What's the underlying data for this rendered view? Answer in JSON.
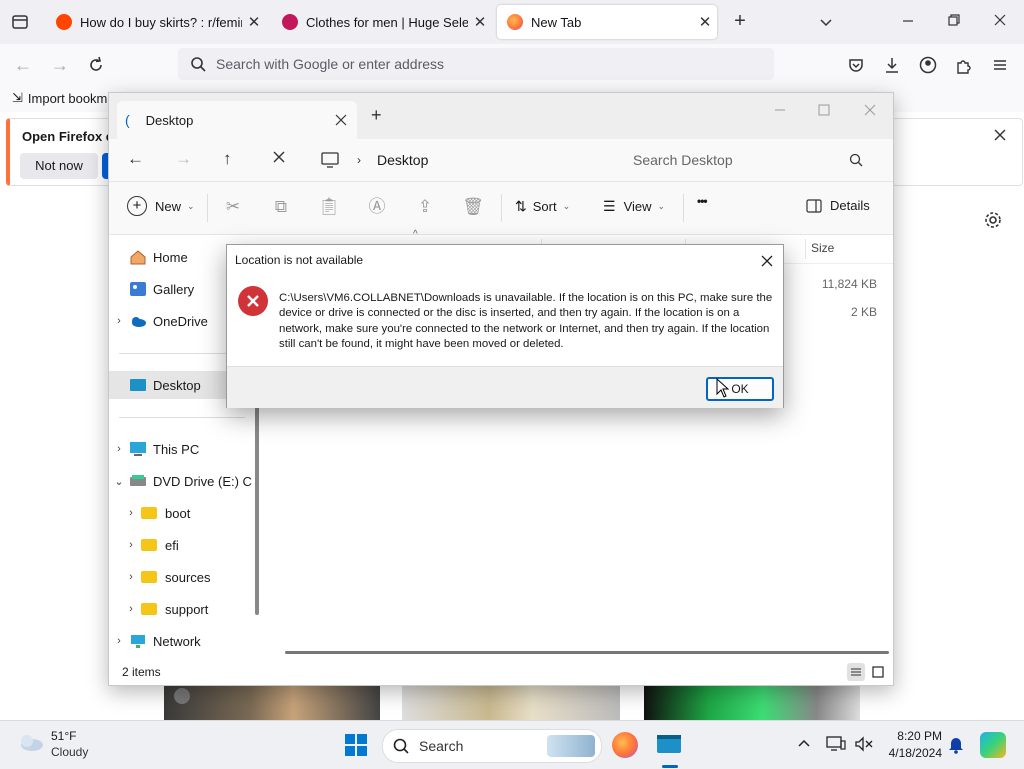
{
  "firefox": {
    "tabs": [
      {
        "title": "How do I buy skirts? : r/feminin",
        "favicon_color": "#ff4500"
      },
      {
        "title": "Clothes for men | Huge Selectio",
        "favicon_color": "#c2185b"
      },
      {
        "title": "New Tab",
        "favicon_color": "#ff7139"
      }
    ],
    "new_tab_symbol": "+",
    "url_placeholder": "Search with Google or enter address",
    "import_bookmarks": "Import bookm",
    "notification": {
      "title": "Open Firefox ev",
      "not_now": "Not now"
    },
    "accent": "#0061e0"
  },
  "explorer": {
    "tab_title": "Desktop",
    "new_tab_symbol": "+",
    "breadcrumb": "Desktop",
    "search_placeholder": "Search Desktop",
    "toolbar": {
      "new": "New",
      "sort": "Sort",
      "view": "View",
      "more": "•••",
      "details": "Details"
    },
    "nav": {
      "home": "Home",
      "gallery": "Gallery",
      "onedrive": "OneDrive",
      "desktop": "Desktop",
      "this_pc": "This PC",
      "dvd": "DVD Drive (E:) C",
      "boot": "boot",
      "efi": "efi",
      "sources": "sources",
      "support": "support",
      "network": "Network"
    },
    "columns": {
      "size": "Size"
    },
    "sizes": [
      "11,824 KB",
      "2 KB"
    ],
    "status": "2 items"
  },
  "dialog": {
    "title": "Location is not available",
    "message": "C:\\Users\\VM6.COLLABNET\\Downloads is unavailable. If the location is on this PC, make sure the device or drive is connected or the disc is inserted, and then try again. If the location is on a network, make sure you're connected to the network or Internet, and then try again. If the location still can't be found, it might have been moved or deleted.",
    "ok": "OK",
    "error_color": "#d13438"
  },
  "taskbar": {
    "weather_temp": "51°F",
    "weather_desc": "Cloudy",
    "search": "Search",
    "time": "8:20 PM",
    "date": "4/18/2024"
  }
}
